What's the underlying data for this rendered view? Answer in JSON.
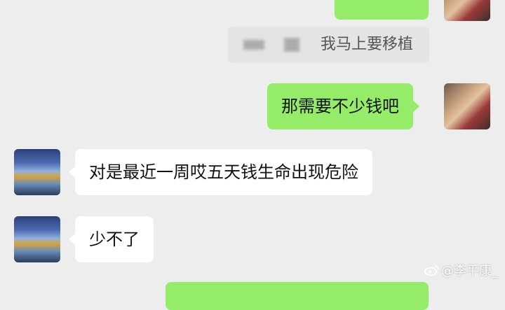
{
  "messages": {
    "quote_text": "我马上要移植",
    "msg_outgoing_1": "那需要不少钱吧",
    "msg_incoming_1": "对是最近一周哎五天钱生命出现危险",
    "msg_incoming_2": "少不了"
  },
  "watermark": {
    "text": "@李平康_",
    "icon": "weibo-icon"
  },
  "colors": {
    "background": "#ededed",
    "outgoing_bubble": "#95ec69",
    "incoming_bubble": "#ffffff",
    "quote_bubble": "#e4e4e4"
  }
}
